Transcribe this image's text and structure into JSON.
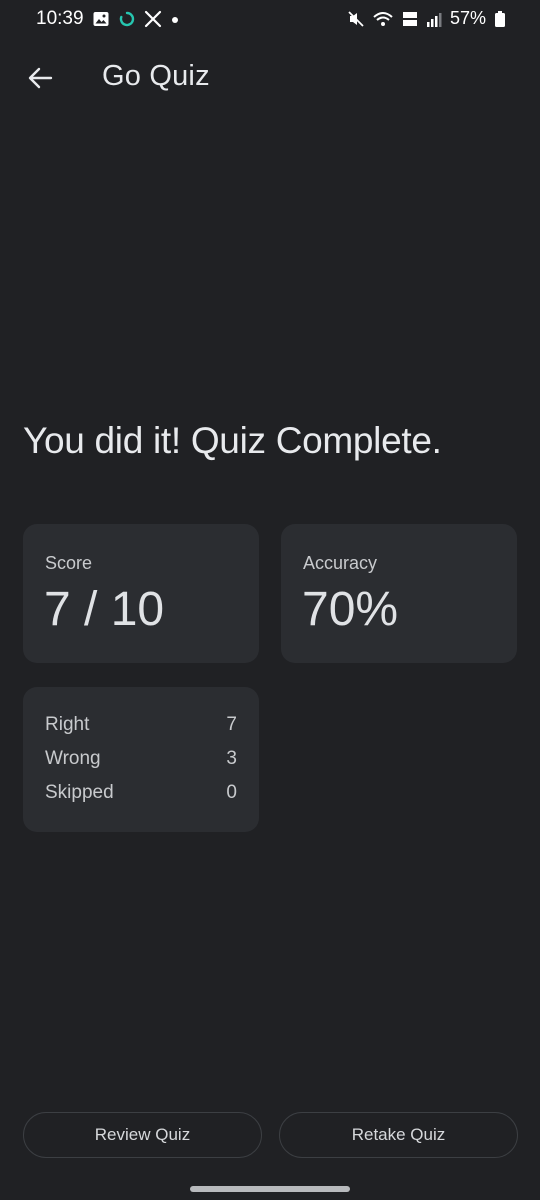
{
  "status_bar": {
    "time": "10:39",
    "battery": "57%",
    "left_icons": [
      "image-icon",
      "sync-icon",
      "x-logo-icon",
      "dot-icon"
    ],
    "right_icons": [
      "mute-icon",
      "wifi-icon",
      "volte-icon",
      "signal-icon",
      "battery-icon"
    ],
    "volte_label": "Vo)) LTE"
  },
  "app_bar": {
    "title": "Go Quiz",
    "back_icon": "arrow-back-icon"
  },
  "result": {
    "headline": "You did it! Quiz Complete.",
    "score_label": "Score",
    "score_value": "7 / 10",
    "accuracy_label": "Accuracy",
    "accuracy_value": "70%",
    "breakdown": {
      "right_label": "Right",
      "right_value": "7",
      "wrong_label": "Wrong",
      "wrong_value": "3",
      "skipped_label": "Skipped",
      "skipped_value": "0"
    }
  },
  "actions": {
    "review_label": "Review Quiz",
    "retake_label": "Retake Quiz"
  },
  "colors": {
    "background": "#202124",
    "card": "#2b2d31",
    "text_primary": "#e8eaed",
    "text_secondary": "#c8cacd",
    "sync_accent": "#26c6b0"
  }
}
